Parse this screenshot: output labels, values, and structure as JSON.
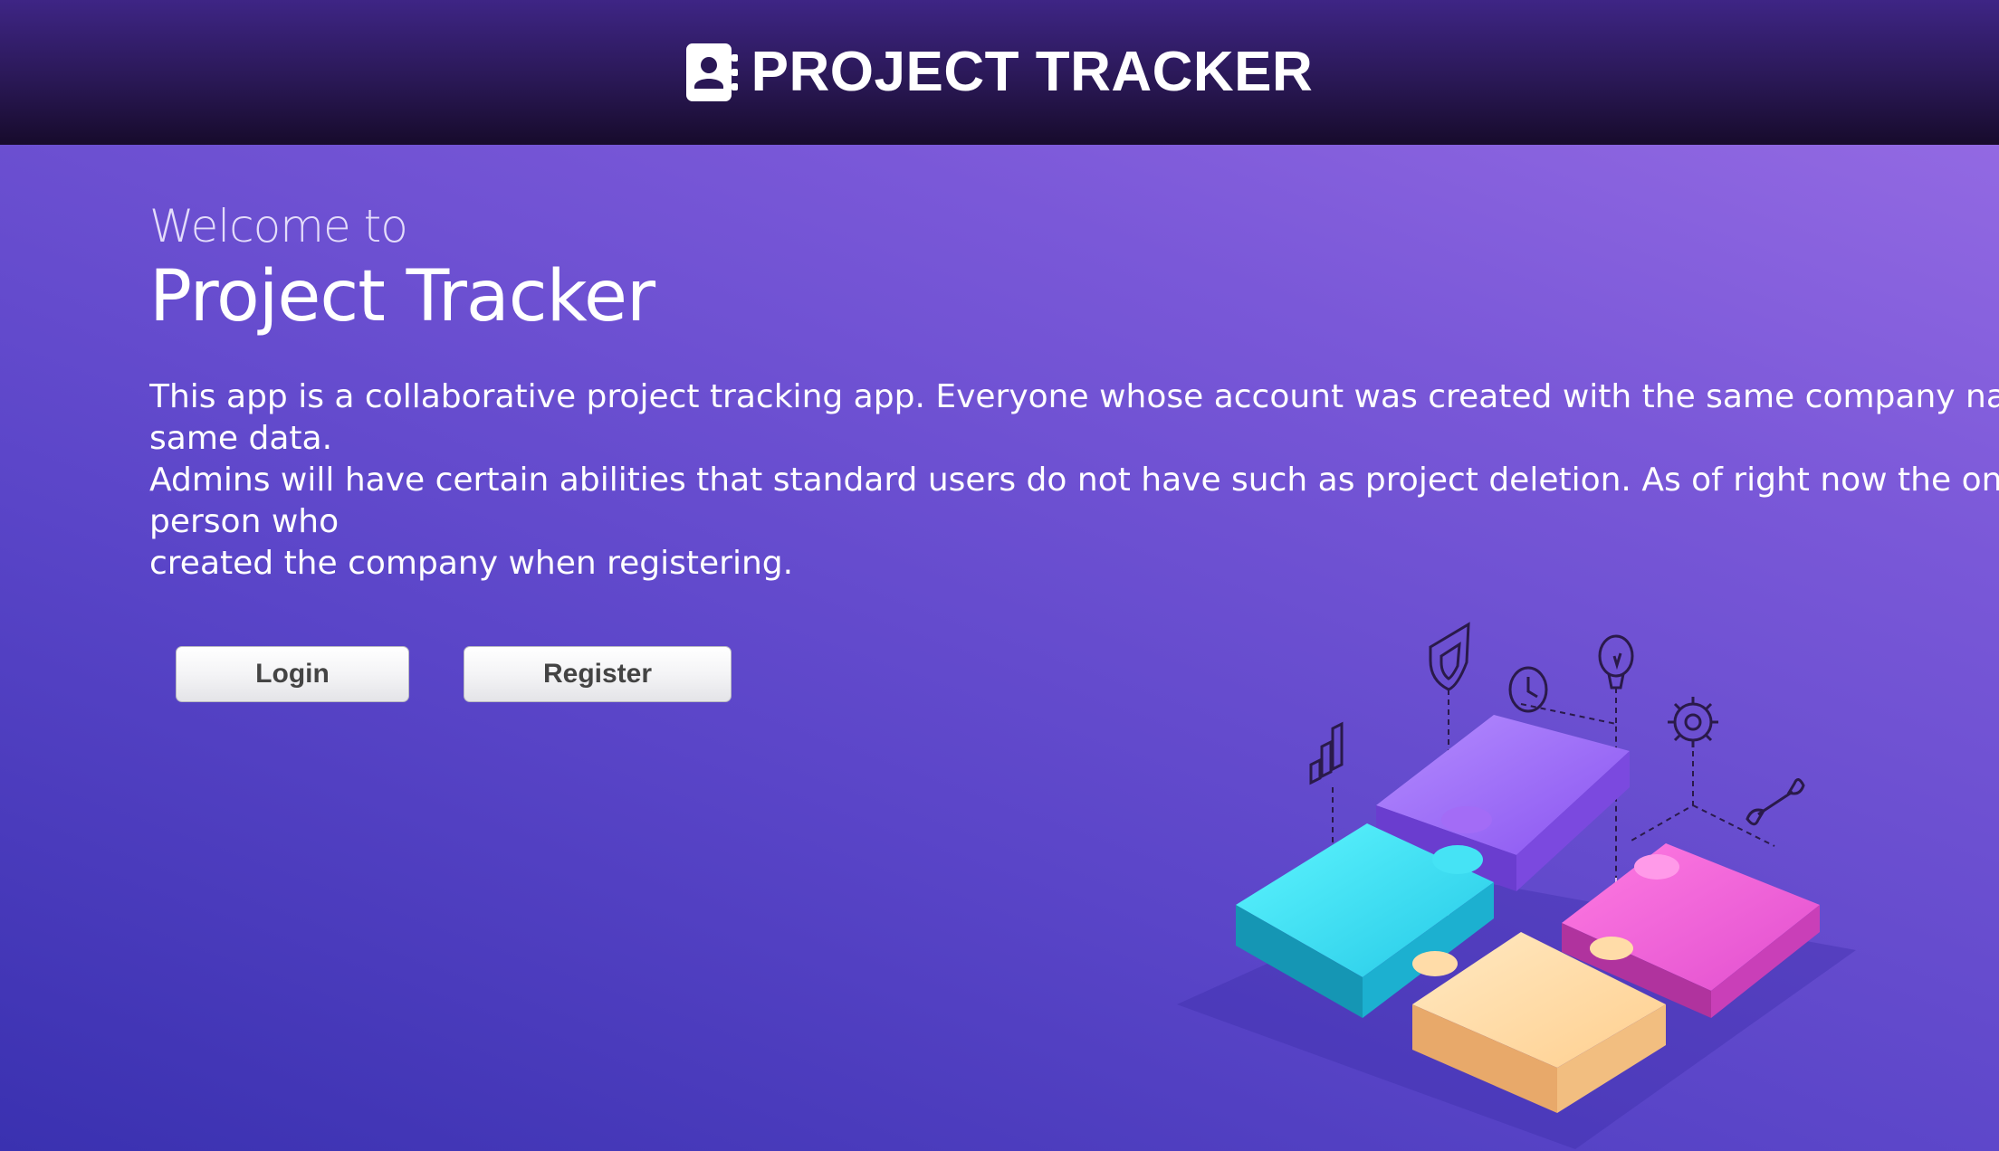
{
  "navbar": {
    "brand_icon": "contact-book-icon",
    "brand_text": "PROJECT TRACKER"
  },
  "hero": {
    "welcome": "Welcome to",
    "title": "Project Tracker",
    "description_lines": [
      "This app is a collaborative project tracking app. Everyone whose account was created with the same company name wi",
      "same data.",
      "Admins will have certain abilities that standard users do not have such as project deletion. As of right now the only adm",
      "person who",
      "created the company when registering."
    ]
  },
  "buttons": {
    "login_label": "Login",
    "register_label": "Register"
  },
  "illustration": {
    "icons": [
      "bar-chart-icon",
      "shield-icon",
      "clock-icon",
      "lightbulb-icon",
      "gear-icon",
      "wrench-icon"
    ],
    "pieces": [
      "cyan",
      "purple",
      "magenta",
      "peach"
    ]
  },
  "colors": {
    "navbar_top": "#3e2585",
    "navbar_bottom": "#170b2c",
    "background_light": "#9b6fe6",
    "background_dark": "#3a31b0",
    "button_text": "#444444"
  }
}
